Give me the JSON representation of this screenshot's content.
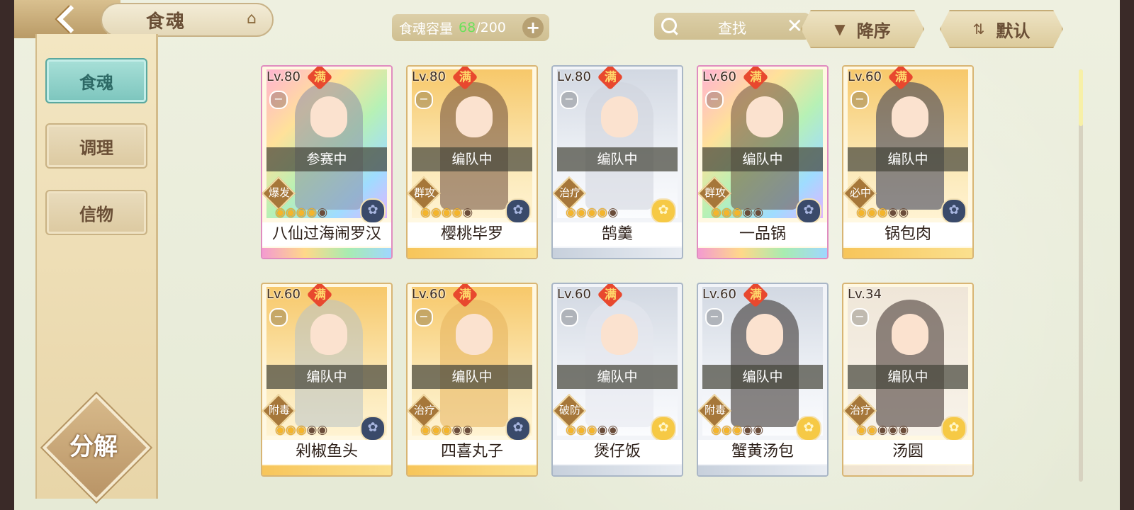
{
  "header": {
    "title": "食魂",
    "capacity_label": "食魂容量",
    "capacity_current": "68",
    "capacity_max": "/200",
    "search_placeholder": "查找",
    "sort_order_label": "降序",
    "sort_mode_label": "默认"
  },
  "sidebar": {
    "items": [
      {
        "label": "食魂",
        "active": true
      },
      {
        "label": "调理",
        "active": false
      },
      {
        "label": "信物",
        "active": false
      }
    ],
    "decompose_label": "分解"
  },
  "cards": [
    {
      "level": "Lv.80",
      "full": "满",
      "status": "参赛中",
      "role": "爆发",
      "stars_on": 4,
      "stars_total": 5,
      "element": "blue",
      "name": "八仙过海闹罗汉",
      "rarity": "rainbow"
    },
    {
      "level": "Lv.80",
      "full": "满",
      "status": "编队中",
      "role": "群攻",
      "stars_on": 4,
      "stars_total": 5,
      "element": "blue",
      "name": "樱桃毕罗",
      "rarity": "gold"
    },
    {
      "level": "Lv.80",
      "full": "满",
      "status": "编队中",
      "role": "治疗",
      "stars_on": 4,
      "stars_total": 5,
      "element": "gold",
      "name": "鹄羹",
      "rarity": "silver"
    },
    {
      "level": "Lv.60",
      "full": "满",
      "status": "编队中",
      "role": "群攻",
      "stars_on": 3,
      "stars_total": 5,
      "element": "blue",
      "name": "一品锅",
      "rarity": "rainbow"
    },
    {
      "level": "Lv.60",
      "full": "满",
      "status": "编队中",
      "role": "必中",
      "stars_on": 3,
      "stars_total": 5,
      "element": "blue",
      "name": "锅包肉",
      "rarity": "gold"
    },
    {
      "level": "Lv.60",
      "full": "满",
      "status": "编队中",
      "role": "附毒",
      "stars_on": 3,
      "stars_total": 5,
      "element": "blue",
      "name": "剁椒鱼头",
      "rarity": "gold"
    },
    {
      "level": "Lv.60",
      "full": "满",
      "status": "编队中",
      "role": "治疗",
      "stars_on": 3,
      "stars_total": 5,
      "element": "blue",
      "name": "四喜丸子",
      "rarity": "gold"
    },
    {
      "level": "Lv.60",
      "full": "满",
      "status": "编队中",
      "role": "破防",
      "stars_on": 3,
      "stars_total": 5,
      "element": "gold",
      "name": "煲仔饭",
      "rarity": "silver"
    },
    {
      "level": "Lv.60",
      "full": "满",
      "status": "编队中",
      "role": "附毒",
      "stars_on": 3,
      "stars_total": 5,
      "element": "gold",
      "name": "蟹黄汤包",
      "rarity": "silver"
    },
    {
      "level": "Lv.34",
      "full": "",
      "status": "编队中",
      "role": "治疗",
      "stars_on": 2,
      "stars_total": 5,
      "element": "gold",
      "name": "汤圆",
      "rarity": "pale"
    }
  ],
  "colors": {
    "accent_teal": "#7cc5bd",
    "capacity_green": "#6be05a",
    "full_badge": "#e8482e"
  }
}
